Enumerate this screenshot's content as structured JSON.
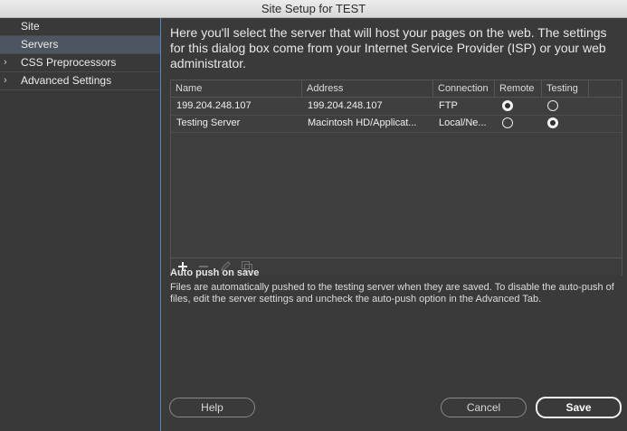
{
  "window": {
    "title": "Site Setup for TEST"
  },
  "sidebar": {
    "items": [
      {
        "label": "Site",
        "expandable": false,
        "selected": false
      },
      {
        "label": "Servers",
        "expandable": false,
        "selected": true
      },
      {
        "label": "CSS Preprocessors",
        "expandable": true,
        "selected": false
      },
      {
        "label": "Advanced Settings",
        "expandable": true,
        "selected": false
      }
    ]
  },
  "intro": "Here you'll select the server that will host your pages on the web. The settings for this dialog box come from your Internet Service Provider (ISP) or your web administrator.",
  "table": {
    "columns": [
      "Name",
      "Address",
      "Connection",
      "Remote",
      "Testing"
    ],
    "rows": [
      {
        "name": "199.204.248.107",
        "address": "199.204.248.107",
        "connection": "FTP",
        "remote": true,
        "testing": false
      },
      {
        "name": "Testing Server",
        "address": "Macintosh HD/Applicat...",
        "connection": "Local/Ne...",
        "remote": false,
        "testing": true
      }
    ],
    "toolbar": [
      "plus-icon",
      "minus-icon",
      "pencil-icon",
      "duplicate-icon"
    ]
  },
  "autopush": {
    "title": "Auto push on save",
    "text": "Files are automatically pushed to the testing server when they are saved. To disable the auto-push of files, edit the server settings and uncheck the auto-push option in the Advanced Tab."
  },
  "buttons": {
    "help": "Help",
    "cancel": "Cancel",
    "save": "Save"
  },
  "colors": {
    "accent": "#4f86c6",
    "background": "#3a3a3a",
    "selected": "#4d5561"
  }
}
